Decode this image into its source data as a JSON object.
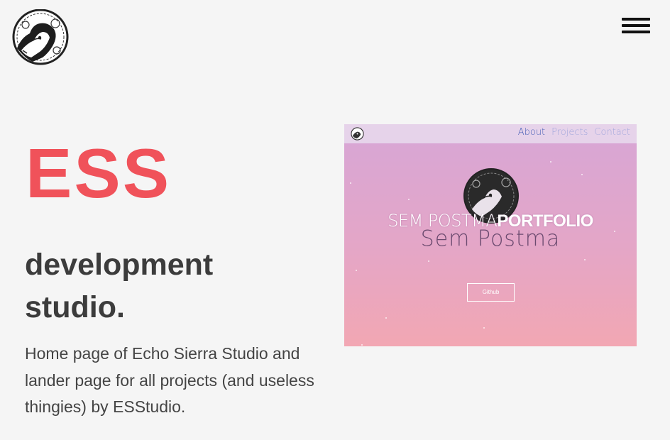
{
  "header": {
    "logo_icon": "dog-emblem-logo-icon",
    "menu_icon": "hamburger-menu-icon"
  },
  "hero": {
    "brand": "ESS",
    "brand_color": "#f0525a",
    "tagline": "development studio.",
    "description": "Home page of Echo Sierra Studio and lander page for all projects (and useless thingies) by ESStudio."
  },
  "preview": {
    "nav": {
      "links": [
        {
          "label": "About",
          "active": true
        },
        {
          "label": "Projects",
          "active": false
        },
        {
          "label": "Contact",
          "active": false
        }
      ]
    },
    "title_light": "SEM POSTMA",
    "title_bold": "PORTFOLIO",
    "subtitle": "Sem Postma",
    "button_label": "Github",
    "colors": {
      "gradient_top": "#d7a6d6",
      "gradient_bottom": "#f2a7b3",
      "nav_bg": "#e6d3ea",
      "nav_active": "#4d63b8",
      "nav_inactive": "#a4a8dc"
    }
  }
}
